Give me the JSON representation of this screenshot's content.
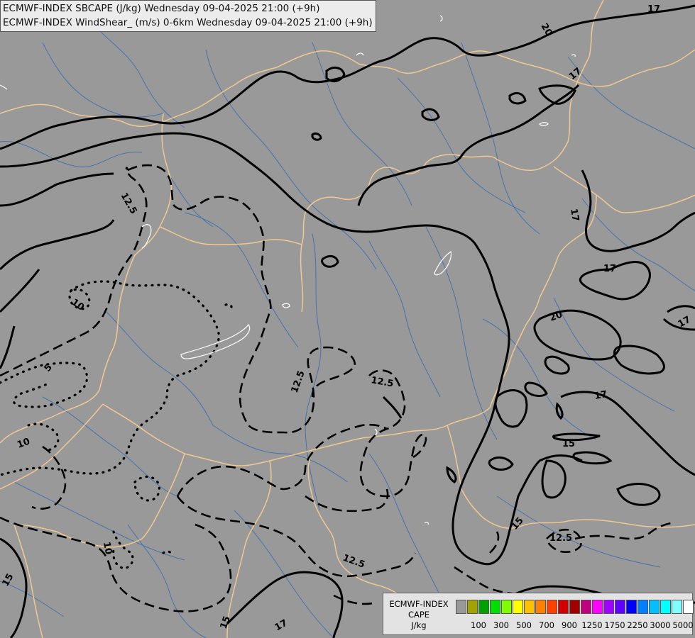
{
  "header": {
    "line1": "ECMWF-INDEX SBCAPE (J/kg) Wednesday 09-04-2025 21:00 (+9h)",
    "line2": "ECMWF-INDEX WindShear_ (m/s) 0-6km Wednesday 09-04-2025 21:00 (+9h)"
  },
  "legend": {
    "title_line1": "ECMWF-INDEX",
    "title_line2": "CAPE",
    "title_line3": "J/kg",
    "colors": [
      "#999999",
      "#a3a300",
      "#00a000",
      "#00e000",
      "#80ff00",
      "#ffff00",
      "#ffc000",
      "#ff8000",
      "#ff4000",
      "#d00000",
      "#a00000",
      "#c00080",
      "#ff00ff",
      "#a000ff",
      "#6000ff",
      "#0000ff",
      "#0080ff",
      "#00c0ff",
      "#00ffff",
      "#80ffff",
      "#ffffff"
    ],
    "ticks": [
      "100",
      "300",
      "500",
      "700",
      "900",
      "1250",
      "1750",
      "2250",
      "3000",
      "5000"
    ]
  },
  "map": {
    "background": "#999999",
    "border_color": "#f0c890",
    "river_color": "#3f6fb0",
    "contour_color": "#000000",
    "contour_labels": [
      "17",
      "20",
      "17",
      "12.5",
      "10",
      "17",
      "17",
      "20",
      "17",
      "5",
      "12.5",
      "12.5",
      "17",
      "15",
      "10",
      "15",
      "10",
      "12.5",
      "12.5",
      "15",
      "15",
      "17"
    ]
  }
}
